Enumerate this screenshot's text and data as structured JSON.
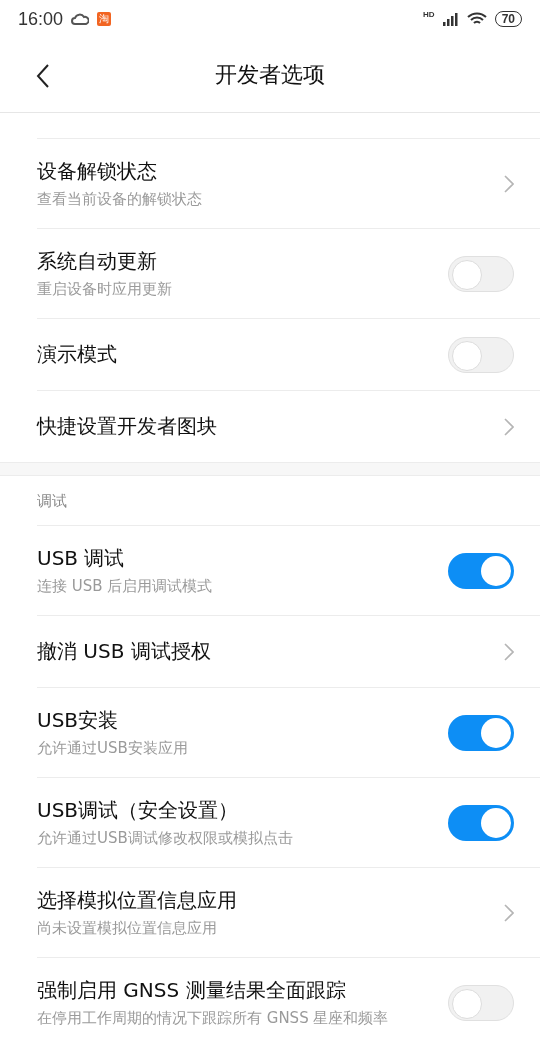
{
  "status_bar": {
    "time": "16:00",
    "app_badge": "淘",
    "battery": "70",
    "network": "HD"
  },
  "header": {
    "title": "开发者选项"
  },
  "groups": [
    {
      "items": [
        {
          "title": "设备解锁状态",
          "subtitle": "查看当前设备的解锁状态",
          "kind": "chevron"
        },
        {
          "title": "系统自动更新",
          "subtitle": "重启设备时应用更新",
          "kind": "toggle",
          "on": false
        },
        {
          "title": "演示模式",
          "kind": "toggle",
          "on": false
        },
        {
          "title": "快捷设置开发者图块",
          "kind": "chevron"
        }
      ]
    },
    {
      "heading": "调试",
      "items": [
        {
          "title": "USB 调试",
          "subtitle": "连接 USB 后启用调试模式",
          "kind": "toggle",
          "on": true
        },
        {
          "title": "撤消 USB 调试授权",
          "kind": "chevron"
        },
        {
          "title": "USB安装",
          "subtitle": "允许通过USB安装应用",
          "kind": "toggle",
          "on": true
        },
        {
          "title": "USB调试（安全设置）",
          "subtitle": "允许通过USB调试修改权限或模拟点击",
          "kind": "toggle",
          "on": true
        },
        {
          "title": "选择模拟位置信息应用",
          "subtitle": "尚未设置模拟位置信息应用",
          "kind": "chevron"
        },
        {
          "title": "强制启用 GNSS 测量结果全面跟踪",
          "subtitle": "在停用工作周期的情况下跟踪所有 GNSS 星座和频率",
          "kind": "toggle",
          "on": false
        }
      ]
    }
  ]
}
